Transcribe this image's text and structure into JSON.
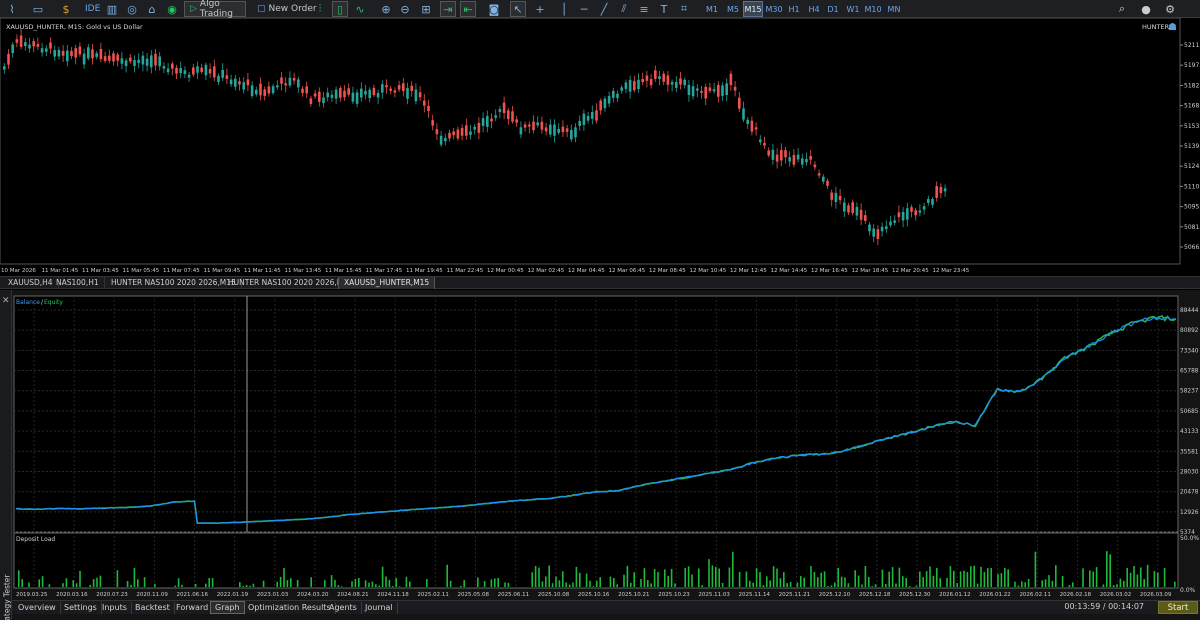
{
  "toolbar": {
    "ide_label": "IDE",
    "algo_trading_label": "Algo Trading",
    "new_order_label": "New Order",
    "timeframes": [
      "M1",
      "M5",
      "M15",
      "M30",
      "H1",
      "H4",
      "D1",
      "W1",
      "M10",
      "MN"
    ],
    "active_timeframe": "M15"
  },
  "chart": {
    "symbol_label": "XAUUSD_HUNTER, M15: Gold vs US Dollar",
    "expert_label": "HUNTER",
    "price_labels": [
      "5211.",
      "5197.",
      "5182.",
      "5168.",
      "5153.",
      "5139.",
      "5124.",
      "5110.",
      "5095.",
      "5081.",
      "5066."
    ],
    "time_labels": [
      "10 Mar 2026",
      "11 Mar 01:45",
      "11 Mar 03:45",
      "11 Mar 05:45",
      "11 Mar 07:45",
      "11 Mar 09:45",
      "11 Mar 11:45",
      "11 Mar 13:45",
      "11 Mar 15:45",
      "11 Mar 17:45",
      "11 Mar 19:45",
      "11 Mar 22:45",
      "12 Mar 00:45",
      "12 Mar 02:45",
      "12 Mar 04:45",
      "12 Mar 06:45",
      "12 Mar 08:45",
      "12 Mar 10:45",
      "12 Mar 12:45",
      "12 Mar 14:45",
      "12 Mar 16:45",
      "12 Mar 18:45",
      "12 Mar 20:45",
      "12 Mar 23:45"
    ],
    "up_color": "#26a69a",
    "down_color": "#ef5350"
  },
  "chart_tabs": [
    "XAUUSD,H4",
    "NAS100,H1",
    "HUNTER NAS100 2020 2026,M15",
    "HUNTER NAS100 2020 2026,M5",
    "XAUUSD_HUNTER,M15"
  ],
  "active_chart_tab": "XAUUSD_HUNTER,M15",
  "graph": {
    "legend_balance": "Balance",
    "legend_sep": "/",
    "legend_equity": "Equity",
    "balance_color": "#1e90ff",
    "equity_color": "#22b14c",
    "y_labels": [
      "88444",
      "80892",
      "73340",
      "65788",
      "58237",
      "50685",
      "43133",
      "35581",
      "28030",
      "20478",
      "12926",
      "5374"
    ],
    "deposit_load_label": "Deposit Load",
    "deposit_top": "50.0%",
    "deposit_bottom": "0.0%",
    "date_labels": [
      "2019.03.25",
      "2020.03.16",
      "2020.07.23",
      "2020.11.09",
      "2021.06.16",
      "2022.01.19",
      "2023.01.03",
      "2024.03.20",
      "2024.08.21",
      "2024.11.18",
      "2025.02.11",
      "2025.05.08",
      "2025.06.11",
      "2025.10.08",
      "2025.10.16",
      "2025.10.21",
      "2025.10.23",
      "2025.11.03",
      "2025.11.14",
      "2025.11.21",
      "2025.12.10",
      "2025.12.18",
      "2025.12.30",
      "2026.01.12",
      "2026.01.22",
      "2026.02.11",
      "2026.02.18",
      "2026.03.02",
      "2026.03.09"
    ]
  },
  "chart_data": {
    "type": "line",
    "series": [
      {
        "name": "Balance",
        "values": [
          12000,
          11800,
          12100,
          12000,
          12300,
          12500,
          13000,
          14500,
          15000,
          6500,
          6800,
          7200,
          7600,
          8000,
          8800,
          9800,
          10500,
          11200,
          11800,
          12400,
          13000,
          14000,
          14800,
          15500,
          16000,
          17200,
          18500,
          19000,
          21000,
          22500,
          24000,
          25500,
          27000,
          29500,
          31500,
          32500,
          33000,
          34000,
          36500,
          39000,
          41000,
          43500,
          45500,
          44000,
          58000,
          57000,
          62000,
          70000,
          74000,
          79000,
          83000,
          85500,
          85000
        ]
      },
      {
        "name": "Equity",
        "values": [
          12000,
          11800,
          12100,
          12000,
          12300,
          12500,
          13000,
          14500,
          15000,
          6500,
          6800,
          7200,
          7600,
          8000,
          8800,
          9800,
          10500,
          11200,
          11800,
          12400,
          13000,
          14000,
          14800,
          15500,
          16000,
          17200,
          18500,
          19000,
          21000,
          22500,
          24000,
          25500,
          27000,
          29500,
          31500,
          32500,
          33000,
          34000,
          36500,
          39000,
          41000,
          43500,
          45500,
          44000,
          58000,
          57000,
          62000,
          70000,
          74000,
          79000,
          83000,
          85500,
          85000
        ]
      }
    ],
    "ylim": [
      5374,
      88444
    ]
  },
  "bottom_tabs": [
    "Overview",
    "Settings",
    "Inputs",
    "Backtest",
    "Forward",
    "Graph",
    "Optimization Results",
    "Agents",
    "Journal"
  ],
  "active_bottom_tab": "Graph",
  "side_label": "Strategy Tester",
  "timer": "00:13:59 / 00:14:07",
  "start_label": "Start"
}
